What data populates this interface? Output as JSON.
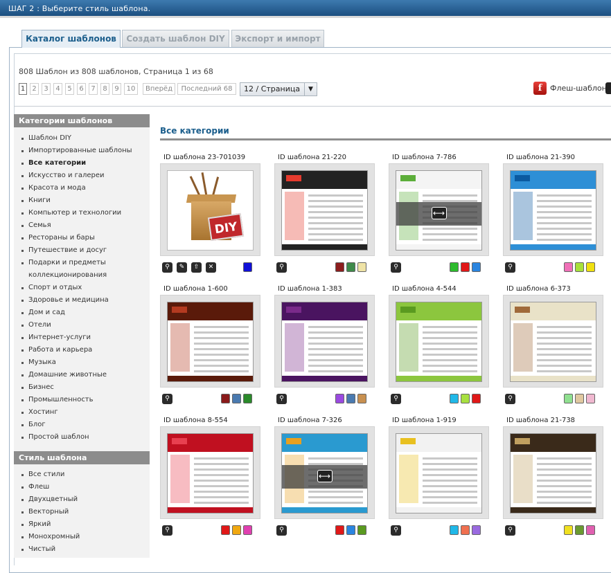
{
  "header": {
    "title": "ШАГ 2 : Выберите стиль шаблона."
  },
  "tabs": [
    {
      "label": "Каталог шаблонов",
      "active": true
    },
    {
      "label": "Создать шаблон DIY",
      "active": false
    },
    {
      "label": "Экспорт и импорт",
      "active": false
    }
  ],
  "summary": "808 Шаблон из 808 шаблонов, Страница 1 из 68",
  "pager": {
    "pages": [
      "1",
      "2",
      "3",
      "4",
      "5",
      "6",
      "7",
      "8",
      "9",
      "10"
    ],
    "current": "1",
    "next_label": "Вперёд",
    "last_label": "Последний 68",
    "per_page": "12 / Страница"
  },
  "flash_filter": {
    "label": "Флеш-шаблон",
    "icon": "flash-icon"
  },
  "sidebar": {
    "categories_title": "Категории шаблонов",
    "categories": [
      "Шаблон DIY",
      "Импортированные шаблоны",
      "Все категории",
      "Искусство и галереи",
      "Красота и мода",
      "Книги",
      "Компьютер и технологии",
      "Семья",
      "Рестораны и бары",
      "Путешествие и досуг",
      "Подарки и предметы коллекционирования",
      "Спорт и отдых",
      "Здоровье и медицина",
      "Дом и сад",
      "Отели",
      "Интернет-услуги",
      "Работа и карьера",
      "Музыка",
      "Домашние животные",
      "Бизнес",
      "Промышленность",
      "Хостинг",
      "Блог",
      "Простой шаблон"
    ],
    "selected_category": "Все категории",
    "style_title": "Стиль шаблона",
    "styles": [
      "Все стили",
      "Флеш",
      "Двухцветный",
      "Векторный",
      "Яркий",
      "Монохромный",
      "Чистый"
    ]
  },
  "main": {
    "title": "Все категории",
    "templates": [
      {
        "id_label": "ID шаблона 23-701039",
        "kind": "diy",
        "tools": [
          "zoom-icon",
          "edit-icon",
          "upload-icon",
          "delete-icon"
        ],
        "swatches": [
          "#1010d8"
        ]
      },
      {
        "id_label": "ID шаблона 21-220",
        "top": "#222222",
        "accent": "#e63b2e",
        "swatches": [
          "#8c1d1d",
          "#3e8a4a",
          "#efe3a6"
        ]
      },
      {
        "id_label": "ID шаблона 7-786",
        "top": "#f4f4f4",
        "accent": "#5cae3a",
        "overlay": true,
        "swatches": [
          "#2dbb2d",
          "#e01818",
          "#2a85e0"
        ]
      },
      {
        "id_label": "ID шаблона 21-390",
        "top": "#2e8fd6",
        "accent": "#0b5aa0",
        "swatches": [
          "#f070b8",
          "#a8e03a",
          "#f0e010"
        ]
      },
      {
        "id_label": "ID шаблона 1-600",
        "top": "#5a1a0a",
        "accent": "#b43a20",
        "swatches": [
          "#8a1a1a",
          "#4a7ab0",
          "#2a8a2a"
        ]
      },
      {
        "id_label": "ID шаблона 1-383",
        "top": "#4a1460",
        "accent": "#7a2a8a",
        "swatches": [
          "#9a4ae0",
          "#4a7ab0",
          "#c89050"
        ]
      },
      {
        "id_label": "ID шаблона 4-544",
        "top": "#8cc63e",
        "accent": "#5a9a20",
        "swatches": [
          "#20b8e8",
          "#a8e040",
          "#e01818"
        ]
      },
      {
        "id_label": "ID шаблона 6-373",
        "top": "#e9e2c8",
        "accent": "#a06a3a",
        "swatches": [
          "#90e090",
          "#e0c8a0",
          "#f0b8d0"
        ]
      },
      {
        "id_label": "ID шаблона 8-554",
        "top": "#c01020",
        "accent": "#e84050",
        "swatches": [
          "#e01818",
          "#f0a810",
          "#e040b0"
        ]
      },
      {
        "id_label": "ID шаблона 7-326",
        "top": "#2a9ad0",
        "accent": "#e8a020",
        "overlay": true,
        "swatches": [
          "#e01818",
          "#2a85e0",
          "#5a9a20"
        ]
      },
      {
        "id_label": "ID шаблона 1-919",
        "top": "#f2f2f2",
        "accent": "#e8c020",
        "swatches": [
          "#20b8e8",
          "#f07050",
          "#9a6ae0"
        ]
      },
      {
        "id_label": "ID шаблона 21-738",
        "top": "#3a2a1a",
        "accent": "#c0a060",
        "swatches": [
          "#f0e020",
          "#6a9a30",
          "#e060b0"
        ]
      }
    ]
  }
}
